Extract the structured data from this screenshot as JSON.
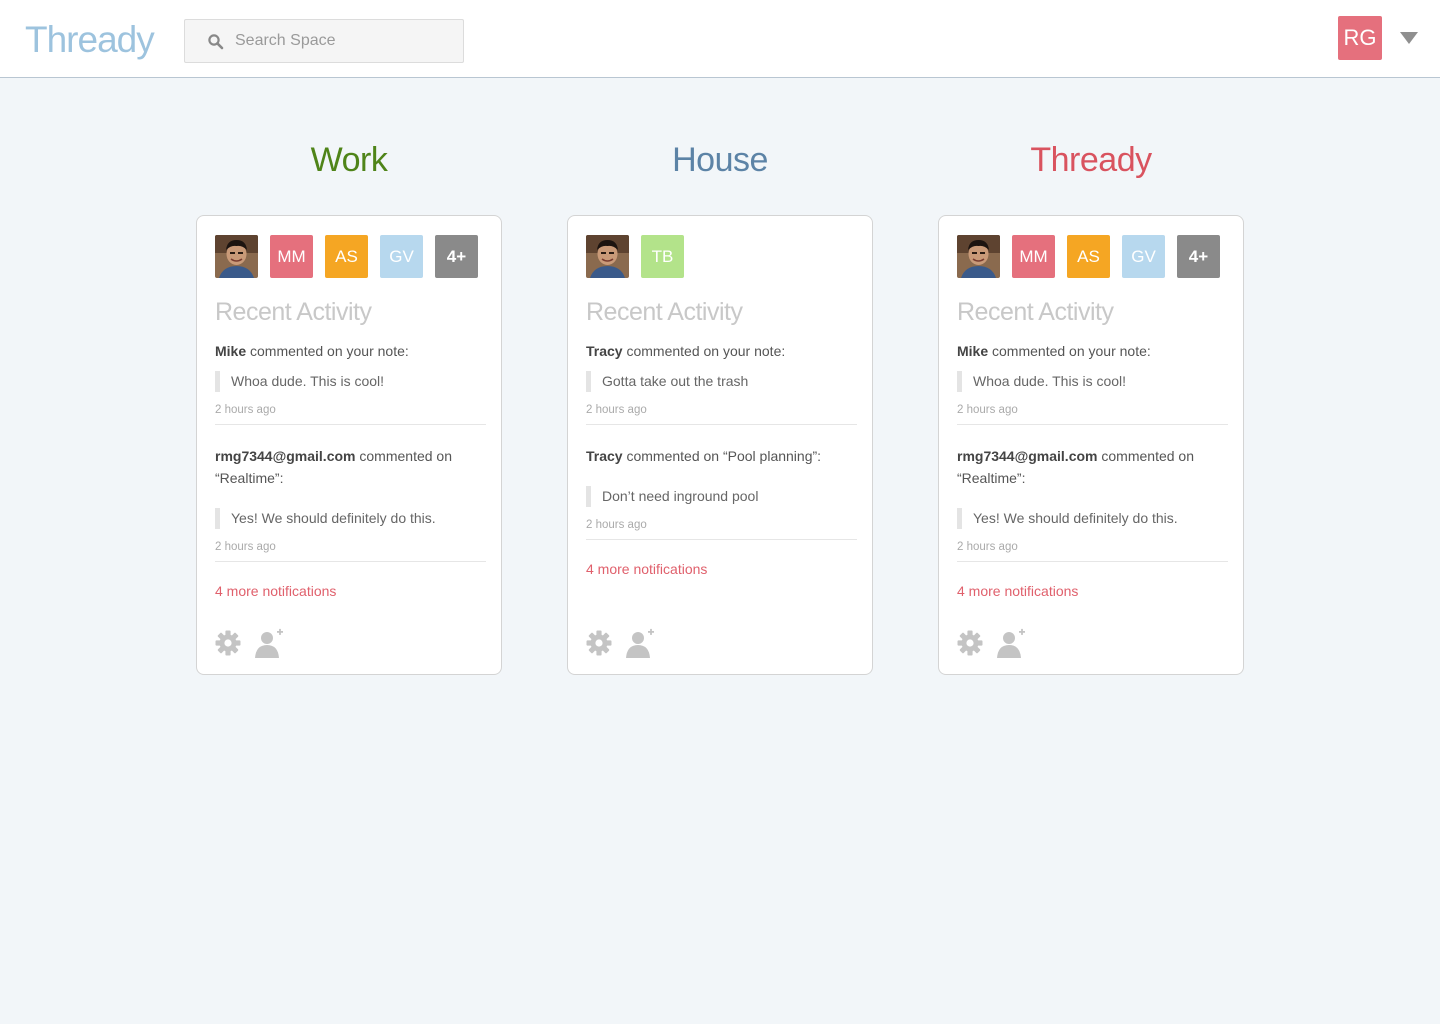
{
  "app": {
    "logo": "Thready",
    "search_placeholder": "Search Space",
    "user_initials": "RG"
  },
  "colors": {
    "logo": "#9dc3de",
    "user_avatar": "#e5707d",
    "link": "#e0606c"
  },
  "spaces": [
    {
      "title": "Work",
      "title_color": "#4f8419",
      "members": [
        {
          "type": "photo",
          "label": ""
        },
        {
          "type": "initials",
          "label": "MM",
          "color": "#e5707d"
        },
        {
          "type": "initials",
          "label": "AS",
          "color": "#f5a623"
        },
        {
          "type": "initials",
          "label": "GV",
          "color": "#b7d8ee"
        },
        {
          "type": "more",
          "label": "4+",
          "color": "#8a8a8a"
        }
      ],
      "recent_activity_title": "Recent Activity",
      "notifications": [
        {
          "actor": "Mike",
          "action": " commented on your note:",
          "quote": "Whoa dude. This is cool!",
          "time": "2 hours ago"
        },
        {
          "actor": "rmg7344@gmail.com",
          "action": " commented on “Realtime”:",
          "quote": "Yes! We should definitely do this.",
          "time": "2 hours ago"
        }
      ],
      "more_notifications": "4 more notifications"
    },
    {
      "title": "House",
      "title_color": "#5c83a6",
      "members": [
        {
          "type": "photo",
          "label": ""
        },
        {
          "type": "initials",
          "label": "TB",
          "color": "#b3e38a"
        }
      ],
      "recent_activity_title": "Recent Activity",
      "notifications": [
        {
          "actor": "Tracy",
          "action": " commented on your note:",
          "quote": "Gotta take out the trash",
          "time": "2 hours ago"
        },
        {
          "actor": "Tracy",
          "action": " commented on “Pool planning”:",
          "quote": "Don’t need inground pool",
          "time": "2 hours ago"
        }
      ],
      "more_notifications": "4 more notifications"
    },
    {
      "title": "Thready",
      "title_color": "#d9535f",
      "members": [
        {
          "type": "photo",
          "label": ""
        },
        {
          "type": "initials",
          "label": "MM",
          "color": "#e5707d"
        },
        {
          "type": "initials",
          "label": "AS",
          "color": "#f5a623"
        },
        {
          "type": "initials",
          "label": "GV",
          "color": "#b7d8ee"
        },
        {
          "type": "more",
          "label": "4+",
          "color": "#8a8a8a"
        }
      ],
      "recent_activity_title": "Recent Activity",
      "notifications": [
        {
          "actor": "Mike",
          "action": " commented on your note:",
          "quote": "Whoa dude. This is cool!",
          "time": "2 hours ago"
        },
        {
          "actor": "rmg7344@gmail.com",
          "action": " commented on “Realtime”:",
          "quote": "Yes! We should definitely do this.",
          "time": "2 hours ago"
        }
      ],
      "more_notifications": "4 more notifications"
    }
  ]
}
